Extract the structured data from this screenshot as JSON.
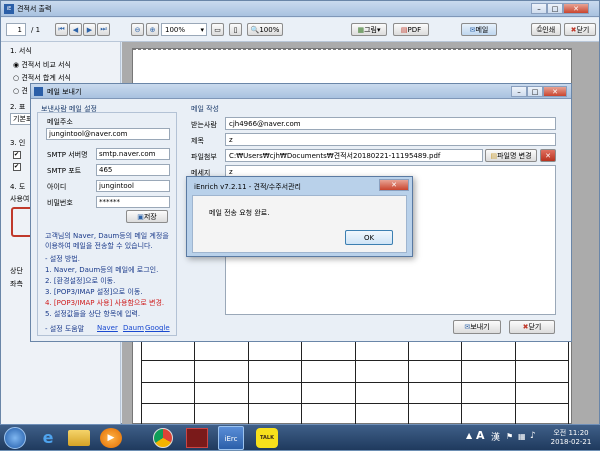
{
  "main_window": {
    "title": "견적서 출력",
    "page_input": "1",
    "page_total": "/ 1",
    "zoom": "100%",
    "zoom_btn": "100%",
    "grid_btn": "그림",
    "pdf_btn": "PDF",
    "mail_btn": "메일",
    "print_btn": "인쇄",
    "close_btn": "닫기"
  },
  "left_panel": {
    "section1": "1. 서식",
    "opt1": "견적서 비교 서식",
    "opt2": "견적서 합계 서식",
    "opt3": "견",
    "frag2": "2. 표",
    "frag_basic": "기본표",
    "frag3": "3. 인",
    "frag4": "4. 도",
    "frag_use": "사용여",
    "frag_top": "상단",
    "frag_left": "좌측"
  },
  "mail_dialog": {
    "title": "메일 보내기",
    "sender_group": "보낸사람 메일 설정",
    "address_label": "메일주소",
    "address_value": "jungintool@naver.com",
    "smtp_server_label": "SMTP 서버명",
    "smtp_server_value": "smtp.naver.com",
    "smtp_port_label": "SMTP 포트",
    "smtp_port_value": "465",
    "id_label": "아이디",
    "id_value": "jungintool",
    "pw_label": "비밀번호",
    "pw_value": "******",
    "save_btn": "저장",
    "info_text": "고객님의 Naver, Daum등의 메일 계정을 이용하여 메일을 전송할 수 있습니다.",
    "guide_title": "- 설정 방법.",
    "steps": [
      "1. Naver, Daum등의 메일에 로그인.",
      "2. [환경설정]으로 이동.",
      "3. [POP3/IMAP 설정]으로 이동.",
      "4. [POP3/IMAP 사용] 사용함으로 변경.",
      "5. 설정값들을 상단 항목에 입력."
    ],
    "help_label": "- 설정 도움말",
    "help_links": [
      "Naver",
      "Daum",
      "Google"
    ],
    "compose_group": "메일 작성",
    "to_label": "받는사람",
    "to_value": "cjh4966@naver.com",
    "subject_label": "제목",
    "subject_value": "z",
    "attach_label": "파일첨부",
    "attach_value": "C:₩Users₩cjh₩Documents₩견적서20180221-11195489.pdf",
    "attach_change_btn": "파일명 변경",
    "message_label": "메세지",
    "message_value": "z",
    "send_btn": "보내기",
    "close_btn": "닫기"
  },
  "alert": {
    "title": "iEnrich v7.2.11 - 견적/수주서관리",
    "message": "메일 전송 요청 완료.",
    "ok": "OK"
  },
  "taskbar": {
    "time": "오전 11:20",
    "date": "2018-02-21",
    "ime_a": "A",
    "ime_han": "漢",
    "ierc": "iErc",
    "talk": "TALK"
  }
}
